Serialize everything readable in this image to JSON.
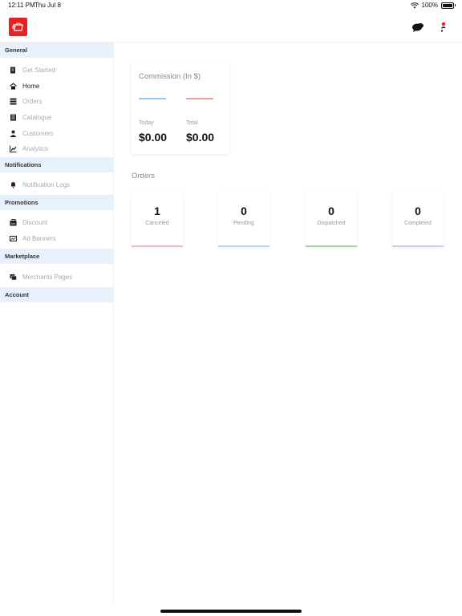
{
  "status_bar": {
    "time": "12:11 PM",
    "date": "Thu Jul 8",
    "battery": "100%"
  },
  "header": {
    "logo_icon": "store-logo-icon",
    "support_icon": "chat-bubbles-icon",
    "profile_icon": "profile-icon"
  },
  "sidebar": {
    "sections": [
      {
        "label": "General",
        "items": [
          {
            "label": "Get Started",
            "icon": "note-icon",
            "active": false
          },
          {
            "label": "Home",
            "icon": "home-icon",
            "active": true
          },
          {
            "label": "Orders",
            "icon": "list-icon",
            "active": false
          },
          {
            "label": "Catalogue",
            "icon": "book-icon",
            "active": false
          },
          {
            "label": "Customers",
            "icon": "person-icon",
            "active": false
          },
          {
            "label": "Analytics",
            "icon": "chart-icon",
            "active": false
          }
        ]
      },
      {
        "label": "Notifications",
        "items": [
          {
            "label": "Notification Logs",
            "icon": "bell-icon",
            "active": false
          }
        ]
      },
      {
        "label": "Promotions",
        "items": [
          {
            "label": "Discount",
            "icon": "tag-icon",
            "active": false
          },
          {
            "label": "Ad Banners",
            "icon": "banner-icon",
            "active": false
          }
        ]
      },
      {
        "label": "Marketplace",
        "items": [
          {
            "label": "Merchants Pages",
            "icon": "pages-icon",
            "active": false
          }
        ]
      },
      {
        "label": "Account",
        "items": []
      }
    ]
  },
  "commission": {
    "title": "Commission (In $)",
    "today_label": "Today",
    "today_value": "$0.00",
    "total_label": "Total",
    "total_value": "$0.00",
    "today_color": "#9ec7ef",
    "total_color": "#ef9f95"
  },
  "orders": {
    "title": "Orders",
    "cards": [
      {
        "count": "1",
        "label": "Canceled",
        "color": "#f4b8be"
      },
      {
        "count": "0",
        "label": "Pending",
        "color": "#b9d8f4"
      },
      {
        "count": "0",
        "label": "Dispatched",
        "color": "#9fd9a0"
      },
      {
        "count": "0",
        "label": "Completed",
        "color": "#c9cdf3"
      }
    ]
  }
}
